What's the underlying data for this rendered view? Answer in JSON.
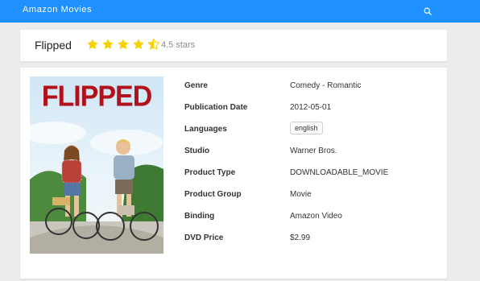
{
  "header": {
    "brand": "Amazon Movies",
    "search_icon": "search-icon",
    "background": "#1e90ff"
  },
  "movie": {
    "title": "Flipped",
    "rating": 4.5,
    "rating_max": 5,
    "rating_text": "4.5 stars",
    "star_color": "#f5d300",
    "poster": {
      "title_text": "FLIPPED",
      "title_color": "#b0121b"
    }
  },
  "details": [
    {
      "label": "Genre",
      "value": "Comedy - Romantic"
    },
    {
      "label": "Publication Date",
      "value": "2012-05-01"
    },
    {
      "label": "Languages",
      "value": "english",
      "style": "tag"
    },
    {
      "label": "Studio",
      "value": "Warner Bros."
    },
    {
      "label": "Product Type",
      "value": "DOWNLOADABLE_MOVIE"
    },
    {
      "label": "Product Group",
      "value": "Movie"
    },
    {
      "label": "Binding",
      "value": "Amazon Video"
    },
    {
      "label": "DVD Price",
      "value": "$2.99"
    }
  ]
}
